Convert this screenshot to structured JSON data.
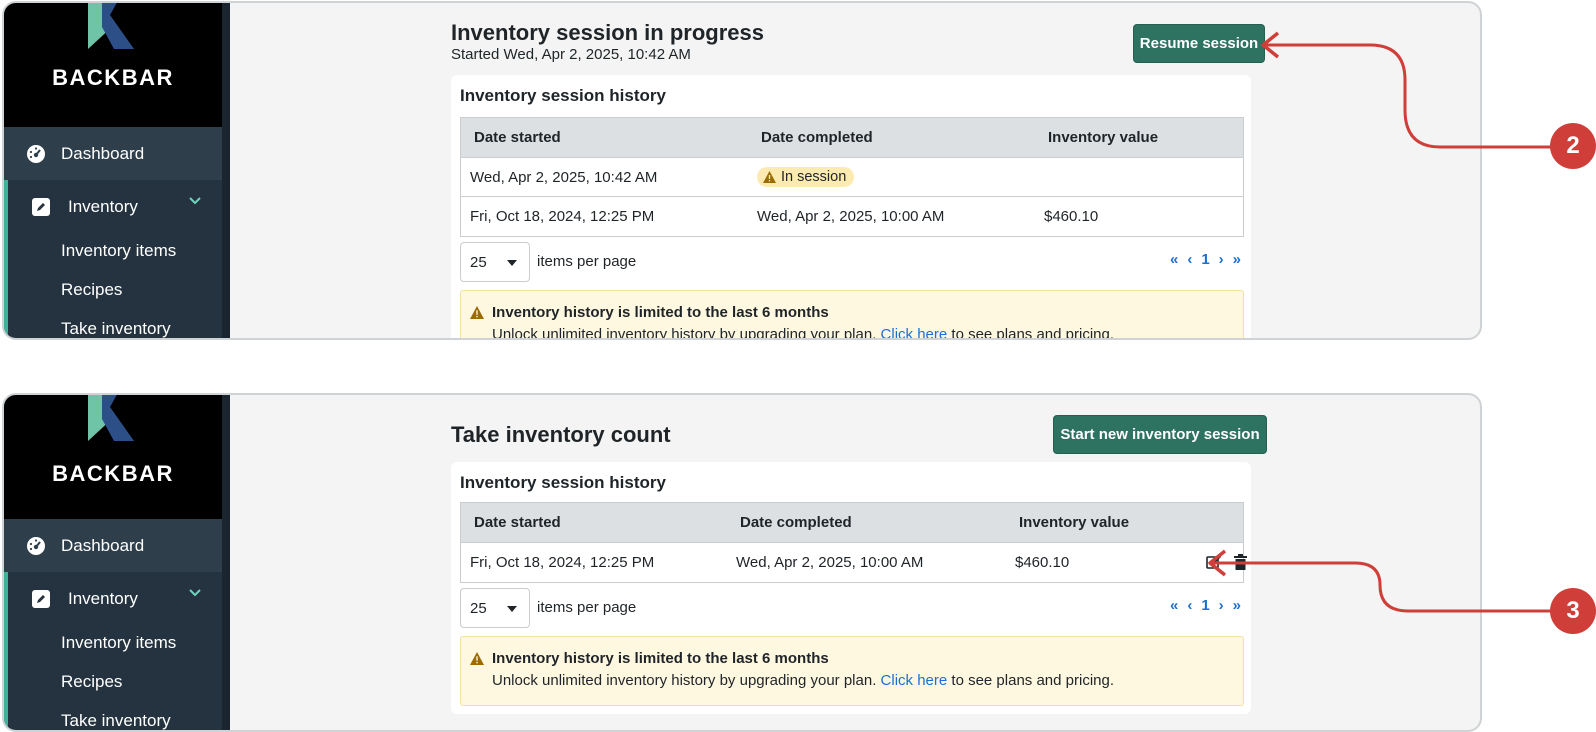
{
  "brand": {
    "name": "BACKBAR",
    "accent": "#2e7262",
    "sidebar_bg": "#24333f",
    "callout_color": "#d03e3a"
  },
  "nav": {
    "dashboard": "Dashboard",
    "inventory": "Inventory",
    "sub_items": [
      "Inventory items",
      "Recipes",
      "Take inventory"
    ]
  },
  "panel_a": {
    "title": "Inventory session in progress",
    "subtitle": "Started Wed, Apr 2, 2025, 10:42 AM",
    "button": "Resume session",
    "card_title": "Inventory session history",
    "columns": [
      "Date started",
      "Date completed",
      "Inventory value"
    ],
    "rows": [
      {
        "started": "Wed, Apr 2, 2025, 10:42 AM",
        "completed": "In session",
        "value": ""
      },
      {
        "started": "Fri, Oct 18, 2024, 12:25 PM",
        "completed": "Wed, Apr 2, 2025, 10:00 AM",
        "value": "$460.10"
      }
    ],
    "per_page": "25",
    "per_page_label": "items per page",
    "page": "1",
    "alert_title": "Inventory history is limited to the last 6 months",
    "alert_text_before": "Unlock unlimited inventory history by upgrading your plan.",
    "alert_link": "Click here",
    "alert_text_after": "to see plans and pricing."
  },
  "panel_b": {
    "title": "Take inventory count",
    "button": "Start new inventory session",
    "card_title": "Inventory session history",
    "columns": [
      "Date started",
      "Date completed",
      "Inventory value"
    ],
    "rows": [
      {
        "started": "Fri, Oct 18, 2024, 12:25 PM",
        "completed": "Wed, Apr 2, 2025, 10:00 AM",
        "value": "$460.10"
      }
    ],
    "per_page": "25",
    "per_page_label": "items per page",
    "page": "1",
    "alert_title": "Inventory history is limited to the last 6 months",
    "alert_text_before": "Unlock unlimited inventory history by upgrading your plan.",
    "alert_link": "Click here",
    "alert_text_after": "to see plans and pricing."
  },
  "callouts": [
    "2",
    "3"
  ],
  "pager_icons": [
    "first-page-icon",
    "prev-page-icon",
    "next-page-icon",
    "last-page-icon"
  ]
}
